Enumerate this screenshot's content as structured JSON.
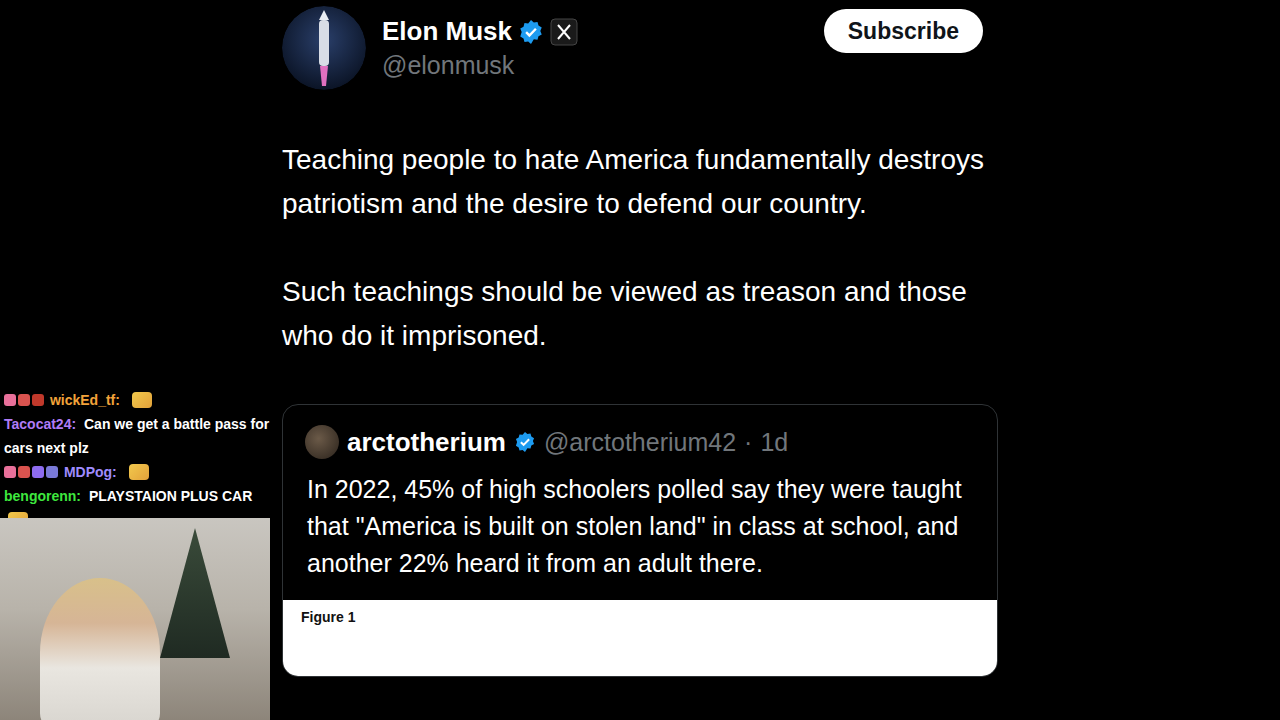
{
  "subscribe_button": "Subscribe",
  "tweet": {
    "name": "Elon Musk",
    "verified": true,
    "handle": "@elonmusk",
    "paragraphs": [
      "Teaching people to hate America fundamentally destroys patriotism and the desire to defend our country.",
      "Such teachings should be viewed as treason and those who do it imprisoned."
    ],
    "quote": {
      "name": "arctotherium",
      "verified": true,
      "handle": "@arctotherium42",
      "separator": "·",
      "time": "1d",
      "text": "In 2022, 45% of high schoolers polled say they were taught that \"America is built on stolen land\" in class at school, and another 22% heard it from an adult there.",
      "figure_label": "Figure 1"
    }
  },
  "chat": [
    {
      "user": "wickEd_tf:",
      "message": "",
      "color": "#f2a33a",
      "badges": [
        "#e8709a",
        "#d9534f",
        "#c0392b"
      ],
      "emote": true
    },
    {
      "user": "Tacocat24:",
      "message": "Can we get a battle pass for cars next plz",
      "color": "#b07cf7",
      "badges": [],
      "emote": false
    },
    {
      "user": "MDPog:",
      "message": "",
      "color": "#9f8cff",
      "badges": [
        "#e8709a",
        "#d9534f",
        "#8e6cf0",
        "#7a7ad8"
      ],
      "emote": true
    },
    {
      "user": "bengorenn:",
      "message": "PLAYSTAION PLUS CAR",
      "color": "#3ee83e",
      "badges": [],
      "emote": true
    }
  ]
}
